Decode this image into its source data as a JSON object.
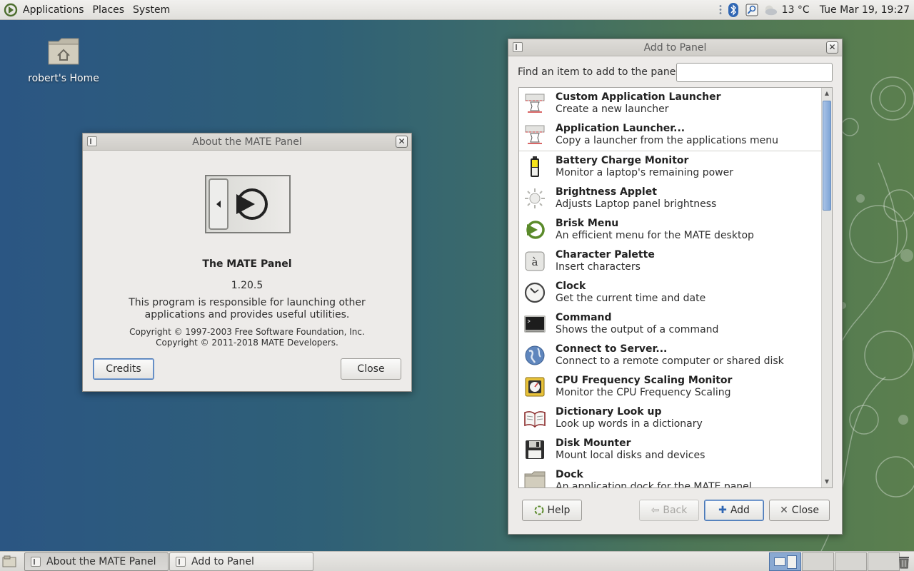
{
  "top_panel": {
    "menus": [
      "Applications",
      "Places",
      "System"
    ],
    "temperature": "13 °C",
    "clock": "Tue Mar 19, 19:27"
  },
  "desktop": {
    "home_icon_label": "robert's Home"
  },
  "about_window": {
    "title": "About the MATE Panel",
    "program_name": "The MATE Panel",
    "version": "1.20.5",
    "description": "This program is responsible for launching other applications and provides useful utilities.",
    "copyright_1": "Copyright © 1997-2003 Free Software Foundation, Inc.",
    "copyright_2": "Copyright © 2011-2018 MATE Developers.",
    "credits_label": "Credits",
    "close_label": "Close"
  },
  "add_panel_window": {
    "title": "Add to Panel",
    "find_label": "Find an item to add to the panel:",
    "find_value": "",
    "items": [
      {
        "name": "Custom Application Launcher",
        "desc": "Create a new launcher",
        "icon": "launcher-icon"
      },
      {
        "name": "Application Launcher...",
        "desc": "Copy a launcher from the applications menu",
        "icon": "launcher-icon"
      },
      {
        "name": "Battery Charge Monitor",
        "desc": "Monitor a laptop's remaining power",
        "icon": "battery-icon"
      },
      {
        "name": "Brightness Applet",
        "desc": "Adjusts Laptop panel brightness",
        "icon": "brightness-icon"
      },
      {
        "name": "Brisk Menu",
        "desc": "An efficient menu for the MATE desktop",
        "icon": "brisk-menu-icon"
      },
      {
        "name": "Character Palette",
        "desc": "Insert characters",
        "icon": "character-palette-icon"
      },
      {
        "name": "Clock",
        "desc": "Get the current time and date",
        "icon": "clock-icon"
      },
      {
        "name": "Command",
        "desc": "Shows the output of a command",
        "icon": "terminal-icon"
      },
      {
        "name": "Connect to Server...",
        "desc": "Connect to a remote computer or shared disk",
        "icon": "globe-icon"
      },
      {
        "name": "CPU Frequency Scaling Monitor",
        "desc": "Monitor the CPU Frequency Scaling",
        "icon": "cpu-gauge-icon"
      },
      {
        "name": "Dictionary Look up",
        "desc": "Look up words in a dictionary",
        "icon": "dictionary-icon"
      },
      {
        "name": "Disk Mounter",
        "desc": "Mount local disks and devices",
        "icon": "floppy-disk-icon"
      },
      {
        "name": "Dock",
        "desc": "An application dock for the MATE panel",
        "icon": "dock-folder-icon"
      }
    ],
    "help_label": "Help",
    "back_label": "Back",
    "add_label": "Add",
    "close_label": "Close"
  },
  "bottom_panel": {
    "tasks": [
      "About the MATE Panel",
      "Add to Panel"
    ]
  }
}
